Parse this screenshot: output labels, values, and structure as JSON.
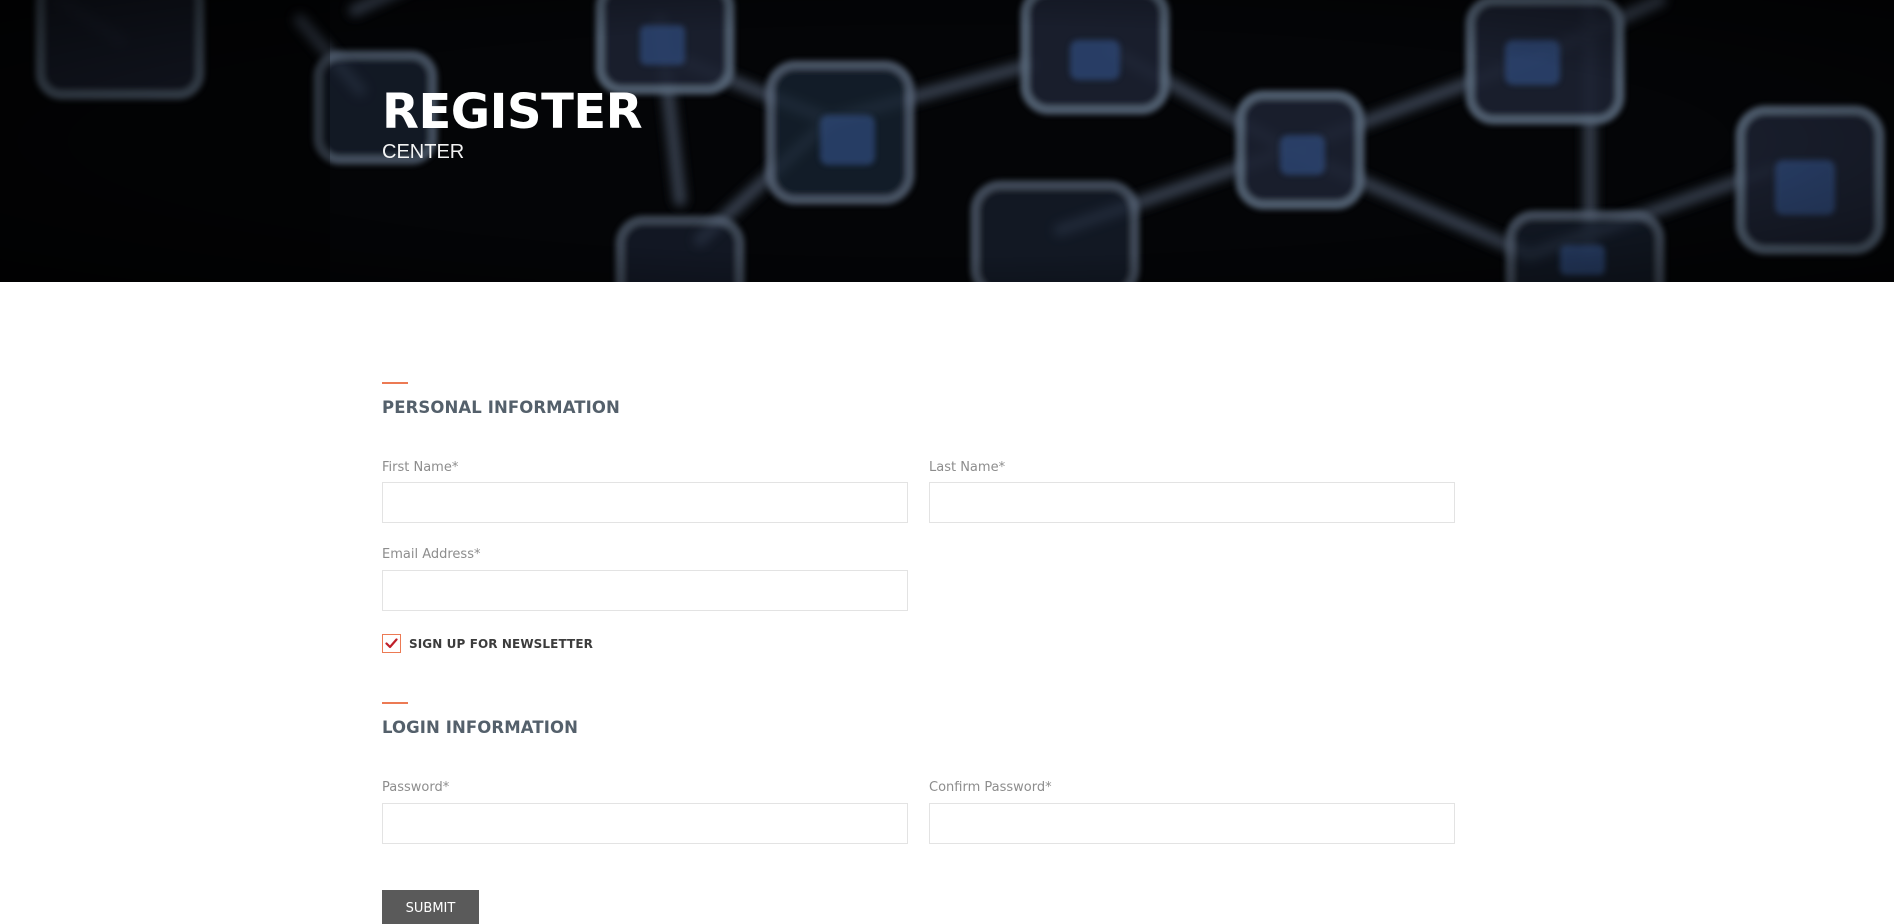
{
  "hero": {
    "title": "REGISTER",
    "subtitle": "CENTER"
  },
  "sections": {
    "personal": {
      "title": "PERSONAL INFORMATION",
      "first_name": {
        "label": "First Name*",
        "value": ""
      },
      "last_name": {
        "label": "Last Name*",
        "value": ""
      },
      "email": {
        "label": "Email Address*",
        "value": ""
      },
      "newsletter": {
        "label": "SIGN UP FOR NEWSLETTER",
        "checked": true
      }
    },
    "login": {
      "title": "LOGIN INFORMATION",
      "password": {
        "label": "Password*",
        "value": ""
      },
      "confirm_password": {
        "label": "Confirm Password*",
        "value": ""
      }
    }
  },
  "actions": {
    "submit_label": "SUBMIT"
  },
  "colors": {
    "accent": "#ec7a54",
    "section_title": "#54606b",
    "button_bg": "#5a5a5a",
    "check_mark": "#c0202a"
  },
  "icons": {
    "checkbox": "check-mark-icon"
  }
}
